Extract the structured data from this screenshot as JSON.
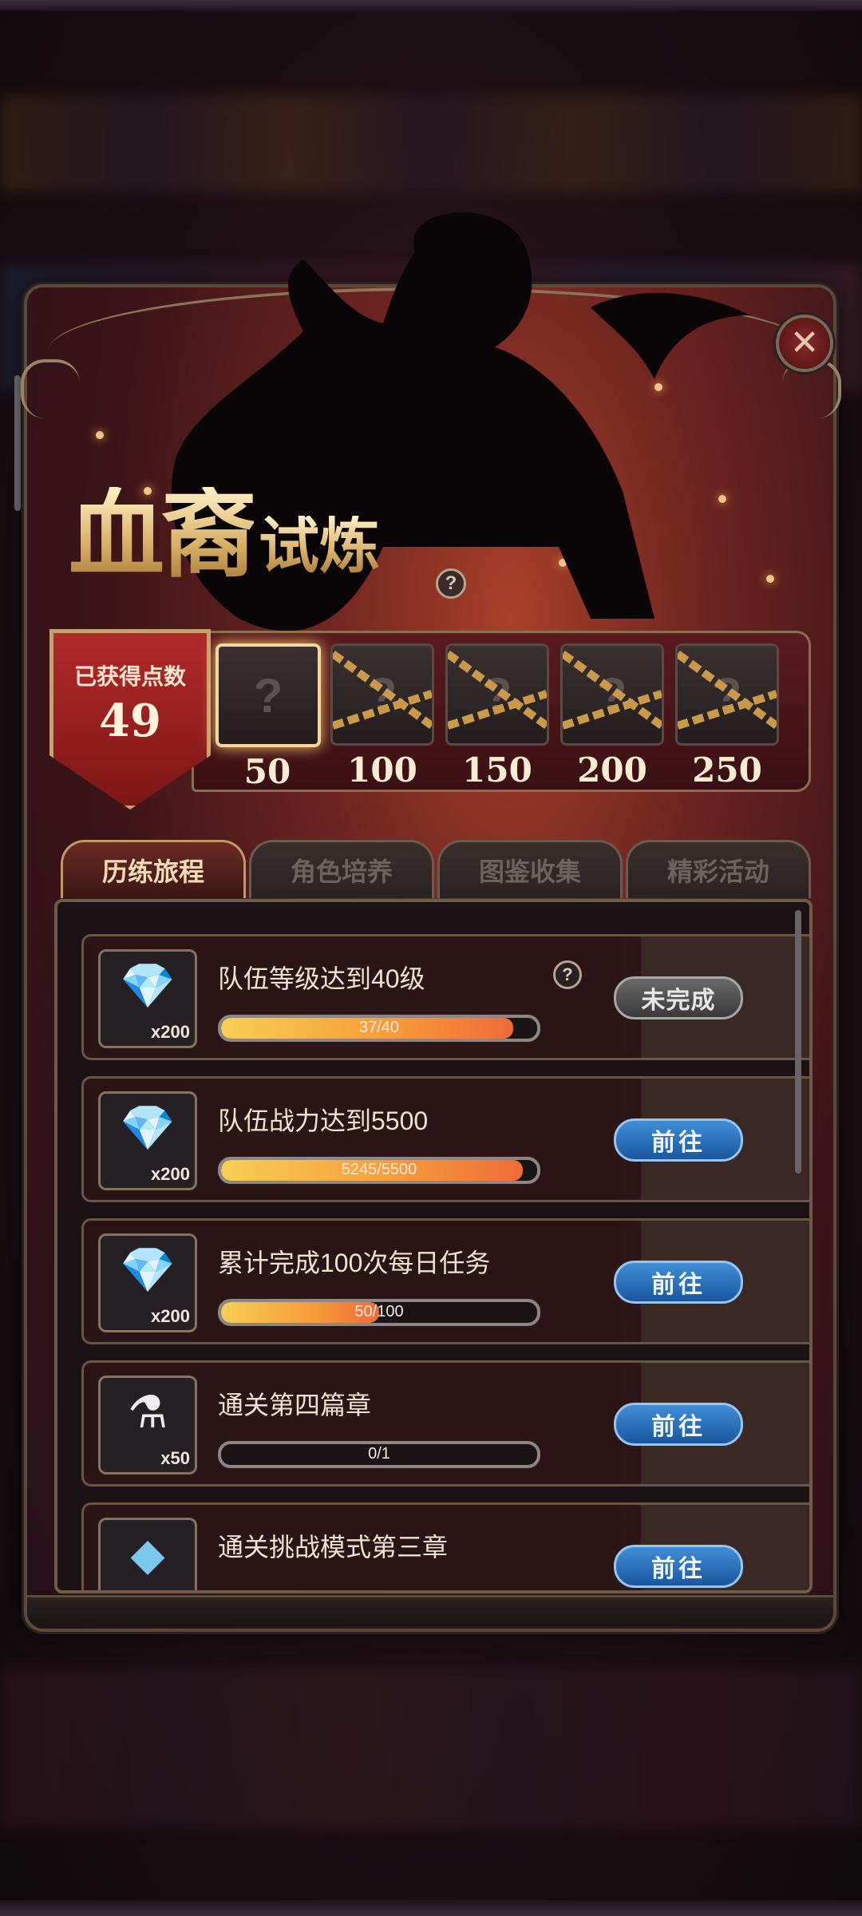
{
  "title": {
    "main": "血裔",
    "sub": "试炼"
  },
  "points": {
    "label": "已获得点数",
    "value": "49"
  },
  "milestones": [
    {
      "value": "50",
      "state": "unknown"
    },
    {
      "value": "100",
      "state": "locked"
    },
    {
      "value": "150",
      "state": "locked"
    },
    {
      "value": "200",
      "state": "locked"
    },
    {
      "value": "250",
      "state": "locked"
    }
  ],
  "tabs": [
    {
      "label": "历练旅程",
      "active": true
    },
    {
      "label": "角色培养",
      "active": false
    },
    {
      "label": "图鉴收集",
      "active": false
    },
    {
      "label": "精彩活动",
      "active": false
    }
  ],
  "tasks": [
    {
      "label": "队伍等级达到40级",
      "reward_icon": "gem-icon",
      "reward_qty": "x200",
      "progress_text": "37/40",
      "progress": 0.925,
      "button": "未完成",
      "status": "incomplete",
      "has_help": true
    },
    {
      "label": "队伍战力达到5500",
      "reward_icon": "gem-icon",
      "reward_qty": "x200",
      "progress_text": "5245/5500",
      "progress": 0.954,
      "button": "前往",
      "status": "go",
      "has_help": false
    },
    {
      "label": "累计完成100次每日任务",
      "reward_icon": "gem-icon",
      "reward_qty": "x200",
      "progress_text": "50/100",
      "progress": 0.5,
      "button": "前往",
      "status": "go",
      "has_help": false
    },
    {
      "label": "通关第四篇章",
      "reward_icon": "potion-icon",
      "reward_qty": "x50",
      "progress_text": "0/1",
      "progress": 0,
      "button": "前往",
      "status": "go",
      "has_help": false
    },
    {
      "label": "通关挑战模式第三章",
      "reward_icon": "crystal-icon",
      "reward_qty": "",
      "progress_text": "",
      "progress": 0,
      "button": "前往",
      "status": "go",
      "has_help": false
    }
  ],
  "colors": {
    "accent_gold": "#f2dcb8",
    "button_blue": "#2a6fc0",
    "panel_red": "#6a2320"
  }
}
